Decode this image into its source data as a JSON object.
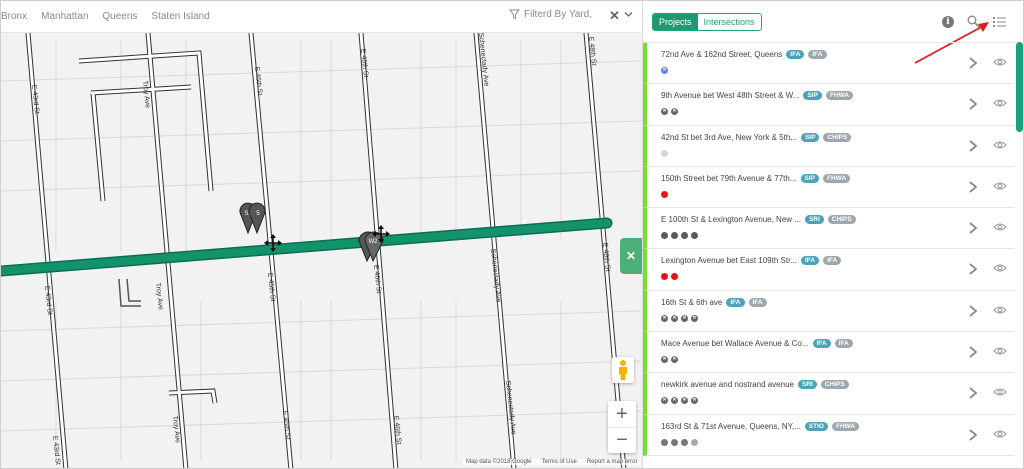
{
  "map": {
    "boroughs": [
      "Bronx",
      "Manhattan",
      "Queens",
      "Staten Island"
    ],
    "filter_text": "Filterd By Yard,",
    "filter_clear_glyph": "✕",
    "close_glyph": "✕",
    "zoom_in": "+",
    "zoom_out": "−",
    "attribution": [
      "Map data ©2018 Google",
      "Terms of Use",
      "Report a map error"
    ],
    "street_labels": [
      "E 43rd St",
      "Troy Ave",
      "E 45th St",
      "E 46th St",
      "Schenectady Ave",
      "E 48th St",
      "E 48"
    ],
    "markers": [
      "S2",
      "5",
      "W2"
    ],
    "route_color": "#13936b"
  },
  "panel": {
    "tabs": [
      {
        "label": "Projects",
        "active": true
      },
      {
        "label": "Intersections",
        "active": false
      }
    ],
    "info_glyph": "i",
    "accent": "#1e9a73",
    "status_bar_color": "#6ee32a",
    "items": [
      {
        "title": "72nd Ave & 162nd Street, Queens",
        "tags": [
          {
            "label": "IFA",
            "color": "#4aa3b8"
          },
          {
            "label": "IFA",
            "color": "#9ea7ad"
          }
        ],
        "dots": [
          {
            "color": "#5b80e8",
            "glyph": "✕"
          }
        ]
      },
      {
        "title": "9th Avenue bet West 48th Street & W...",
        "tags": [
          {
            "label": "SIP",
            "color": "#4aa3b8"
          },
          {
            "label": "FHWA",
            "color": "#9ea7ad"
          }
        ],
        "dots": [
          {
            "color": "#666666",
            "glyph": "✕"
          },
          {
            "color": "#666666",
            "glyph": "✕"
          }
        ]
      },
      {
        "title": "42nd St bet 3rd Ave, New York & 5th...",
        "tags": [
          {
            "label": "SIP",
            "color": "#4aa3b8"
          },
          {
            "label": "CHIPS",
            "color": "#9ea7ad"
          }
        ],
        "dots": [
          {
            "color": "#d4d4d4",
            "glyph": ""
          }
        ]
      },
      {
        "title": "150th Street bet 79th Avenue & 77th...",
        "tags": [
          {
            "label": "SIP",
            "color": "#4aa3b8"
          },
          {
            "label": "FHWA",
            "color": "#9ea7ad"
          }
        ],
        "dots": [
          {
            "color": "#ee1111",
            "glyph": ""
          }
        ]
      },
      {
        "title": "E 100th St & Lexington Avenue, New ...",
        "tags": [
          {
            "label": "SRI",
            "color": "#4aa3b8"
          },
          {
            "label": "CHIPS",
            "color": "#9ea7ad"
          }
        ],
        "dots": [
          {
            "color": "#5a5a5a",
            "glyph": ""
          },
          {
            "color": "#5a5a5a",
            "glyph": ""
          },
          {
            "color": "#5a5a5a",
            "glyph": ""
          },
          {
            "color": "#5a5a5a",
            "glyph": ""
          }
        ]
      },
      {
        "title": "Lexington Avenue bet East 109th Str...",
        "tags": [
          {
            "label": "IFA",
            "color": "#4aa3b8"
          },
          {
            "label": "IFA",
            "color": "#9ea7ad"
          }
        ],
        "dots": [
          {
            "color": "#ee1111",
            "glyph": ""
          },
          {
            "color": "#ee1111",
            "glyph": ""
          }
        ]
      },
      {
        "title": "16th St & 6th ave",
        "tags": [
          {
            "label": "IFA",
            "color": "#4aa3b8"
          },
          {
            "label": "IFA",
            "color": "#9ea7ad"
          }
        ],
        "dots": [
          {
            "color": "#666666",
            "glyph": "✕"
          },
          {
            "color": "#666666",
            "glyph": "✕"
          },
          {
            "color": "#666666",
            "glyph": "✕"
          },
          {
            "color": "#666666",
            "glyph": "✕"
          }
        ]
      },
      {
        "title": "Mace Avenue bet Wallace Avenue & Co...",
        "tags": [
          {
            "label": "IFA",
            "color": "#4aa3b8"
          },
          {
            "label": "IFA",
            "color": "#9ea7ad"
          }
        ],
        "dots": [
          {
            "color": "#666666",
            "glyph": "✕"
          },
          {
            "color": "#666666",
            "glyph": "✕"
          }
        ]
      },
      {
        "title": "newkirk avenue and nostrand avenue",
        "tags": [
          {
            "label": "SRI",
            "color": "#4aa3b8"
          },
          {
            "label": "CHIPS",
            "color": "#9ea7ad"
          }
        ],
        "dots": [
          {
            "color": "#666666",
            "glyph": "✕"
          },
          {
            "color": "#666666",
            "glyph": "✕"
          },
          {
            "color": "#666666",
            "glyph": "✕"
          },
          {
            "color": "#666666",
            "glyph": "✕"
          }
        ]
      },
      {
        "title": "163rd St & 71st Avenue, Queens, NY,...",
        "tags": [
          {
            "label": "STIO",
            "color": "#4aa3b8"
          },
          {
            "label": "FHWA",
            "color": "#9ea7ad"
          }
        ],
        "dots": [
          {
            "color": "#777777",
            "glyph": ""
          },
          {
            "color": "#777777",
            "glyph": ""
          },
          {
            "color": "#777777",
            "glyph": ""
          },
          {
            "color": "#aaaaaa",
            "glyph": ""
          }
        ]
      }
    ]
  }
}
